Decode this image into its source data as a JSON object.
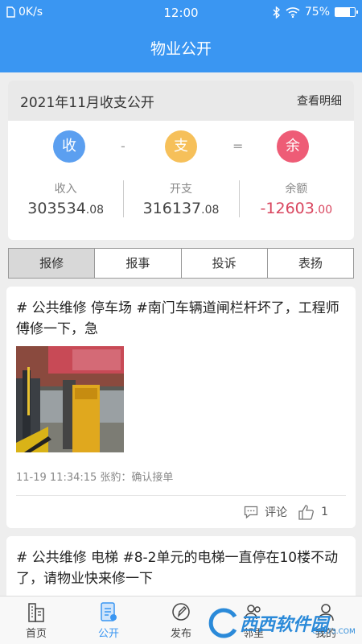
{
  "status_bar": {
    "network_speed": "0K/s",
    "time": "12:00",
    "battery": "75%",
    "battery_level": 0.75
  },
  "header": {
    "title": "物业公开"
  },
  "summary": {
    "title": "2021年11月收支公开",
    "detail_link": "查看明细",
    "income_icon": "收",
    "expense_icon": "支",
    "balance_icon": "余",
    "minus": "-",
    "equals": "=",
    "income_label": "收入",
    "income_int": "303534",
    "income_dec": ".08",
    "expense_label": "开支",
    "expense_int": "316137",
    "expense_dec": ".08",
    "balance_label": "余额",
    "balance_int": "-12603",
    "balance_dec": ".00",
    "colors": {
      "income": "#5b9ff0",
      "expense": "#f6c05a",
      "balance": "#ee5c76"
    }
  },
  "tabs": [
    {
      "label": "报修",
      "active": true
    },
    {
      "label": "报事",
      "active": false
    },
    {
      "label": "投诉",
      "active": false
    },
    {
      "label": "表扬",
      "active": false
    }
  ],
  "posts": [
    {
      "text": "# 公共维修 停车场 #南门车辆道闸栏杆坏了，工程师傅修一下，急",
      "meta": "11-19 11:34:15 张豹：确认接单",
      "comment_label": "评论",
      "like_count": "1"
    },
    {
      "text": "# 公共维修 电梯 #8-2单元的电梯一直停在10楼不动了，请物业快来修一下"
    }
  ],
  "bottom_nav": [
    {
      "label": "首页",
      "icon": "building-icon"
    },
    {
      "label": "公开",
      "icon": "document-icon",
      "active": true
    },
    {
      "label": "发布",
      "icon": "edit-icon"
    },
    {
      "label": "邻里",
      "icon": "people-icon"
    },
    {
      "label": "我的",
      "icon": "person-icon"
    }
  ],
  "watermark": {
    "text": "西西软件园",
    "sub": "CR173.COM"
  }
}
